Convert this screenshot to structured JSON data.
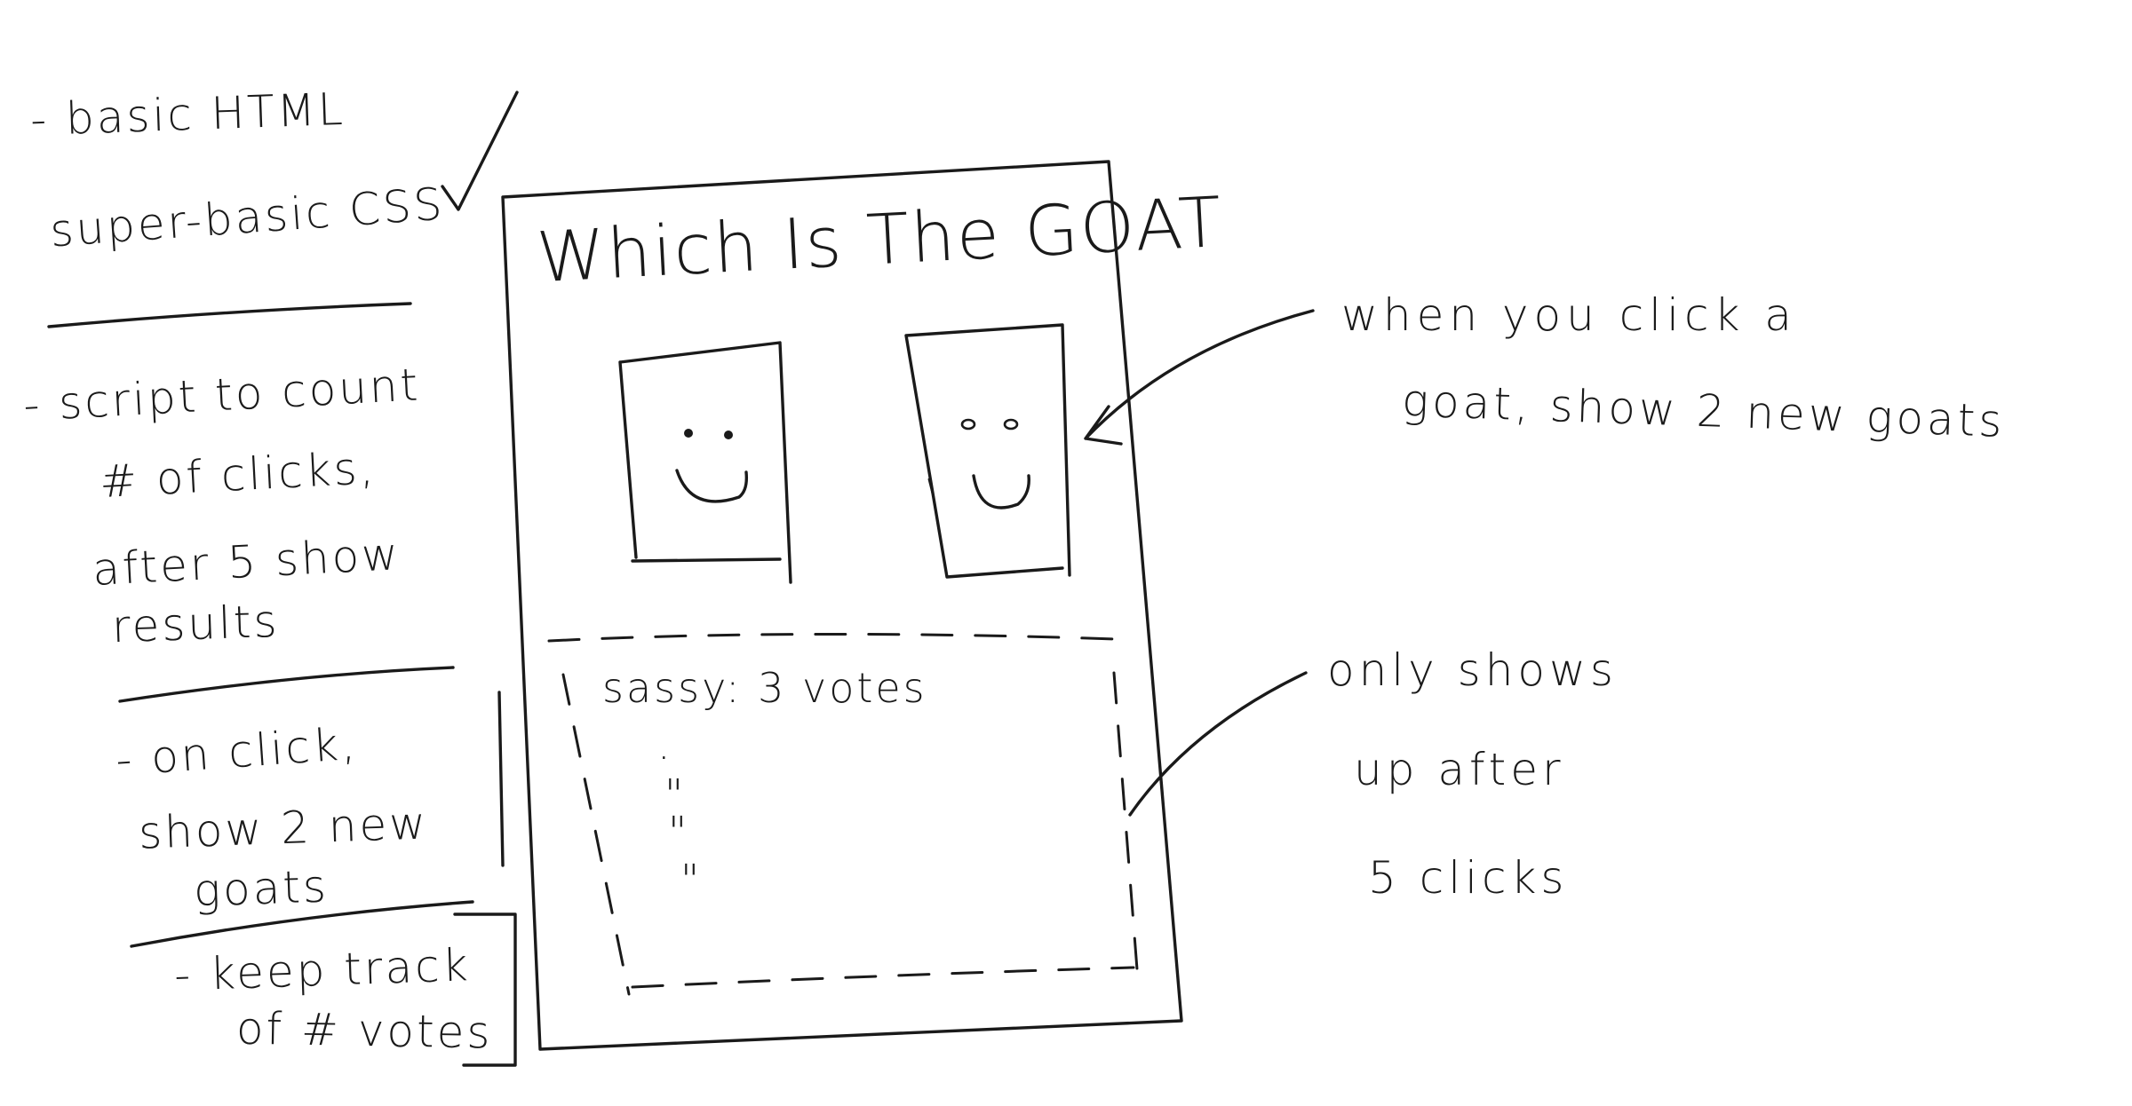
{
  "wireframe": {
    "title": "Which Is The GOAT",
    "results_first_entry": "sassy: 3 votes",
    "results_ditto_marks": [
      "·",
      "\"",
      "\"",
      "\""
    ]
  },
  "notes": {
    "left": {
      "item1_line1": "- basic HTML",
      "item1_line2": "super-basic CSS",
      "checkmark": "✓",
      "item2_line1": "- script to count",
      "item2_line2": "# of clicks,",
      "item2_line3": "after 5 show",
      "item2_line4": "results",
      "item3_line1": "- on click,",
      "item3_line2": "show 2 new",
      "item3_line3": "goats",
      "item4_line1": "- keep track",
      "item4_line2": "of # votes"
    },
    "right": {
      "annotation1_line1": "when you click a",
      "annotation1_line2": "goat, show 2 new goats",
      "annotation2_line1": "only shows",
      "annotation2_line2": "up after",
      "annotation2_line3": "5 clicks"
    }
  }
}
